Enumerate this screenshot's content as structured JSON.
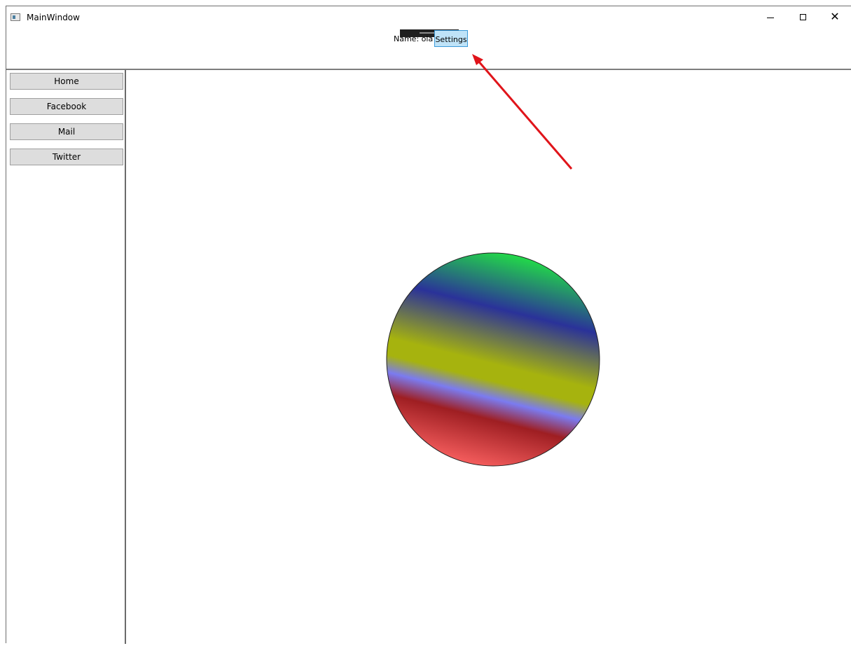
{
  "window": {
    "title": "MainWindow"
  },
  "caption": {
    "minimize": "minimize-icon",
    "maximize": "maximize-icon",
    "close": "close-icon"
  },
  "header": {
    "name_label": "Name: ola",
    "settings_label": "Settings"
  },
  "sidebar": {
    "items": [
      {
        "label": "Home"
      },
      {
        "label": "Facebook"
      },
      {
        "label": "Mail"
      },
      {
        "label": "Twitter"
      }
    ]
  },
  "colors": {
    "gradient_stops": [
      "#22d64a",
      "#2a3299",
      "#a6b30e",
      "#7b7bf0",
      "#9e1e22",
      "#f25b5b"
    ],
    "annotation_arrow": "#e0141a"
  }
}
